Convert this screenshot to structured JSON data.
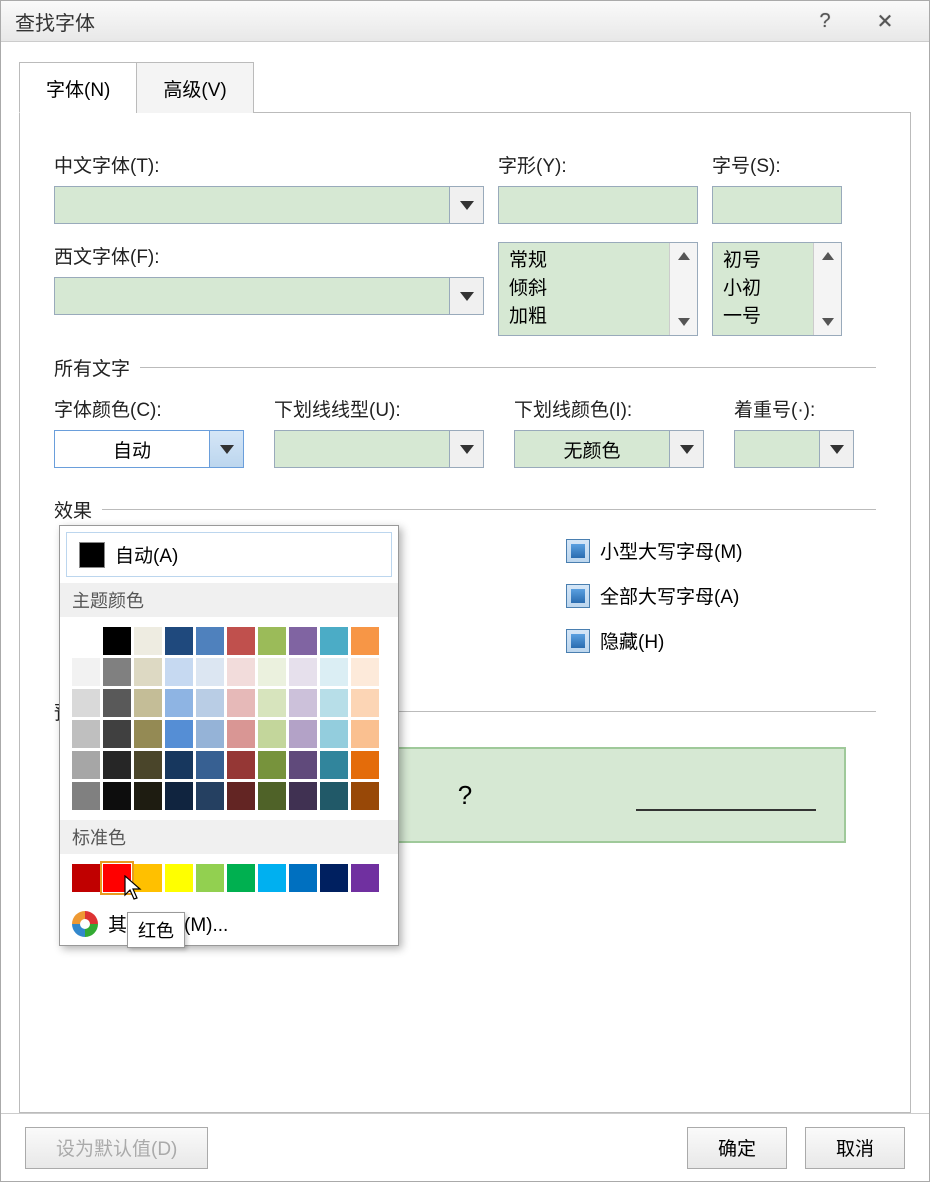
{
  "title": "查找字体",
  "tabs": {
    "font": "字体(N)",
    "advanced": "高级(V)"
  },
  "labels": {
    "cfont": "中文字体(T):",
    "wfont": "西文字体(F):",
    "style": "字形(Y):",
    "size": "字号(S):",
    "alltext": "所有文字",
    "fontcolor": "字体颜色(C):",
    "ulstyle": "下划线线型(U):",
    "ulcolor": "下划线颜色(I):",
    "emph": "着重号(·):",
    "effects": "效果",
    "preview": "预览"
  },
  "styleOptions": [
    "常规",
    "倾斜",
    "加粗"
  ],
  "sizeOptions": [
    "初号",
    "小初",
    "一号"
  ],
  "fontcolorValue": "自动",
  "ulcolorValue": "无颜色",
  "checkboxes": {
    "smallcaps": "小型大写字母(M)",
    "allcaps": "全部大写字母(A)",
    "hidden": "隐藏(H)"
  },
  "popup": {
    "auto": "自动(A)",
    "theme": "主题颜色",
    "standard": "标准色",
    "more": "其他颜色(M)...",
    "tooltip": "红色",
    "themeRows": [
      [
        "#ffffff",
        "#000000",
        "#eeece1",
        "#1f497d",
        "#4f81bd",
        "#c0504d",
        "#9bbb59",
        "#8064a2",
        "#4bacc6",
        "#f79646"
      ],
      [
        "#f2f2f2",
        "#808080",
        "#ddd9c3",
        "#c6d9f1",
        "#dce6f2",
        "#f2dcdb",
        "#ebf1de",
        "#e6e0ec",
        "#dbeef4",
        "#fdeada"
      ],
      [
        "#d9d9d9",
        "#595959",
        "#c4bd97",
        "#8eb4e3",
        "#b9cde5",
        "#e6b9b8",
        "#d7e4bd",
        "#ccc1da",
        "#b7dee8",
        "#fcd5b5"
      ],
      [
        "#bfbfbf",
        "#404040",
        "#948a54",
        "#558ed5",
        "#95b3d7",
        "#d99694",
        "#c3d69b",
        "#b3a2c7",
        "#93cddd",
        "#fac090"
      ],
      [
        "#a6a6a6",
        "#262626",
        "#4a452a",
        "#17375e",
        "#376092",
        "#953735",
        "#77933c",
        "#604a7b",
        "#31859c",
        "#e46c0a"
      ],
      [
        "#808080",
        "#0d0d0d",
        "#1e1c11",
        "#10243f",
        "#254061",
        "#632523",
        "#4f6228",
        "#403152",
        "#215968",
        "#984807"
      ]
    ],
    "standardColors": [
      "#c00000",
      "#ff0000",
      "#ffc000",
      "#ffff00",
      "#92d050",
      "#00b050",
      "#00b0f0",
      "#0070c0",
      "#002060",
      "#7030a0"
    ]
  },
  "previewChar": "?",
  "buttons": {
    "default": "设为默认值(D)",
    "ok": "确定",
    "cancel": "取消"
  }
}
